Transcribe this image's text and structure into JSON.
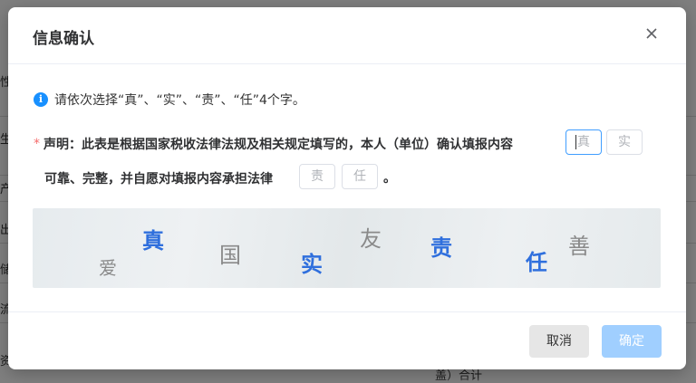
{
  "background": {
    "row_labels": [
      "性",
      "生",
      "产",
      "出",
      "储",
      "流",
      "资"
    ],
    "footer_text": "盖）合计"
  },
  "dialog": {
    "title": "信息确认",
    "close_icon": "close-icon",
    "info": {
      "icon": "info-icon",
      "icon_glyph": "i",
      "text": "请依次选择“真”、“实”、“责”、“任”4个字。"
    },
    "declaration": {
      "required_mark": "*",
      "label": "声明：",
      "text_part1": "此表是根据国家税收法律法规及相关规定填写的，本人（单位）确认填报内容",
      "text_part2": "可靠、完整，并自愿对填报内容承担法律",
      "text_end": "。",
      "char_boxes": [
        {
          "placeholder": "真",
          "active": true
        },
        {
          "placeholder": "实",
          "active": false
        },
        {
          "placeholder": "责",
          "active": false
        },
        {
          "placeholder": "任",
          "active": false
        }
      ]
    },
    "captcha": {
      "chars": [
        {
          "char": "爱",
          "style": "grey"
        },
        {
          "char": "真",
          "style": "blue"
        },
        {
          "char": "国",
          "style": "grey"
        },
        {
          "char": "实",
          "style": "blue"
        },
        {
          "char": "友",
          "style": "grey"
        },
        {
          "char": "责",
          "style": "blue"
        },
        {
          "char": "任",
          "style": "blue"
        },
        {
          "char": "善",
          "style": "grey"
        }
      ]
    },
    "footer": {
      "cancel_label": "取消",
      "ok_label": "确定"
    }
  },
  "colors": {
    "accent": "#409eff",
    "info_icon": "#1890ff",
    "captcha_highlight": "#2f6fdd",
    "ok_button_disabled": "#a0cfff",
    "required": "#f56c6c"
  }
}
